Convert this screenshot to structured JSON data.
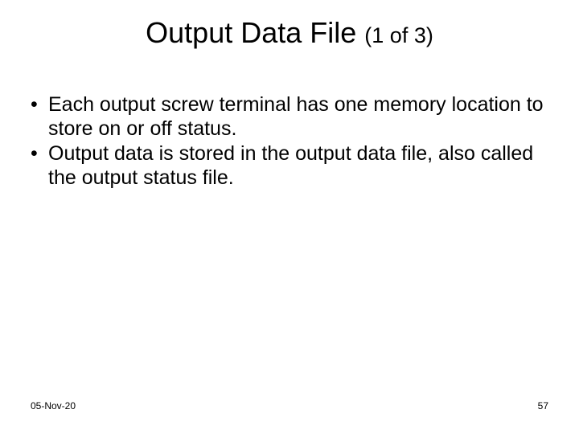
{
  "title": {
    "main": "Output Data File",
    "part": "(1 of 3)"
  },
  "bullets": [
    "Each output screw terminal has one memory location to store on or off status.",
    "Output data is stored in the output data file, also called the output status file."
  ],
  "footer": {
    "date": "05-Nov-20",
    "page": "57"
  }
}
